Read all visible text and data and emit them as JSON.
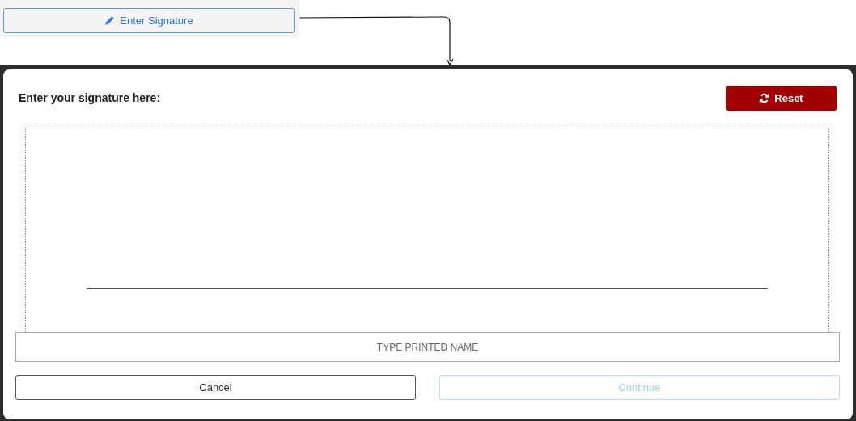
{
  "trigger_button": {
    "label": "Enter Signature"
  },
  "dialog": {
    "title": "Enter your signature here:",
    "reset_button": {
      "label": "Reset"
    },
    "name_field": {
      "placeholder": "TYPE PRINTED NAME"
    },
    "buttons": [
      {
        "label": "Cancel",
        "disabled": false
      },
      {
        "label": "Continue",
        "disabled": true
      }
    ]
  }
}
